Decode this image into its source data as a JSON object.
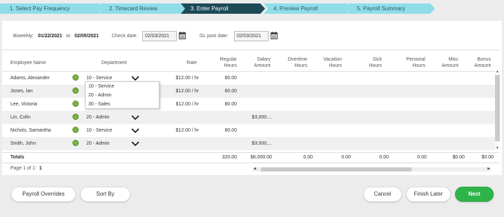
{
  "wizard": {
    "steps": [
      {
        "label": "1.  Select Pay Frequency"
      },
      {
        "label": "2.  Timecard Review"
      },
      {
        "label": "3.  Enter Payroll"
      },
      {
        "label": "4.  Preview Payroll"
      },
      {
        "label": "5.  Payroll Summary"
      }
    ],
    "active_index": 2
  },
  "filters": {
    "period_label": "Biweekly:",
    "period_start": "01/22/2021",
    "to_label": "to",
    "period_end": "02/05/2021",
    "check_date_label": "Check date:",
    "check_date": "02/03/2021",
    "gl_post_label": "GL post date:",
    "gl_post_date": "02/03/2021"
  },
  "table": {
    "headers": {
      "employee": "Employee Name",
      "department": "Department",
      "rate": "Rate",
      "regular_hours": [
        "Regular",
        "Hours"
      ],
      "salary_amount": [
        "Salary",
        "Amount"
      ],
      "overtime_hours": [
        "Overtime",
        "Hours"
      ],
      "vacation_hours": [
        "Vacation",
        "Hours"
      ],
      "sick_hours": [
        "Sick",
        "Hours"
      ],
      "personal_hours": [
        "Personal",
        "Hours"
      ],
      "misc_amount": [
        "Misc",
        "Amount"
      ],
      "bonus_amount": [
        "Bonus",
        "Amount"
      ]
    },
    "rows": [
      {
        "name": "Adams, Alexander",
        "department": "10 - Service",
        "rate": "$12.00 / hr",
        "regular_hours": "80.00",
        "salary": ""
      },
      {
        "name": "Jones, Ian",
        "department": "10 - Service",
        "rate": "$12.00 / hr",
        "regular_hours": "80.00",
        "salary": ""
      },
      {
        "name": "Lee, Victoria",
        "department": "",
        "rate": "$12.00 / hr",
        "regular_hours": "80.00",
        "salary": ""
      },
      {
        "name": "Lin, Colin",
        "department": "20 - Admin",
        "rate": "",
        "regular_hours": "",
        "salary": "$3,000...."
      },
      {
        "name": "Nichols, Samantha",
        "department": "10 - Service",
        "rate": "$12.00 / hr",
        "regular_hours": "80.00",
        "salary": ""
      },
      {
        "name": "Smith, John",
        "department": "20 - Admin",
        "rate": "",
        "regular_hours": "",
        "salary": "$3,000...."
      }
    ],
    "department_options": [
      "10 - Service",
      "20 - Admin",
      "30 - Sales"
    ],
    "totals": {
      "label": "Totals",
      "regular_hours": "320.00",
      "salary": "$6,000.00",
      "overtime": "0.00",
      "vacation": "0.00",
      "sick": "0.00",
      "personal": "0.00",
      "misc": "$0.00",
      "bonus": "$0.00"
    }
  },
  "pager": {
    "text": "Page 1 of 1:",
    "current": "1"
  },
  "buttons": {
    "payroll_overrides": "Payroll Overrides",
    "sort_by": "Sort By",
    "cancel": "Cancel",
    "finish_later": "Finish Later",
    "next": "Next"
  },
  "colors": {
    "step_fill": "#8fdde8",
    "step_active": "#1d4a57",
    "green_dot": "#7cb342",
    "next_button": "#2fb44a"
  }
}
